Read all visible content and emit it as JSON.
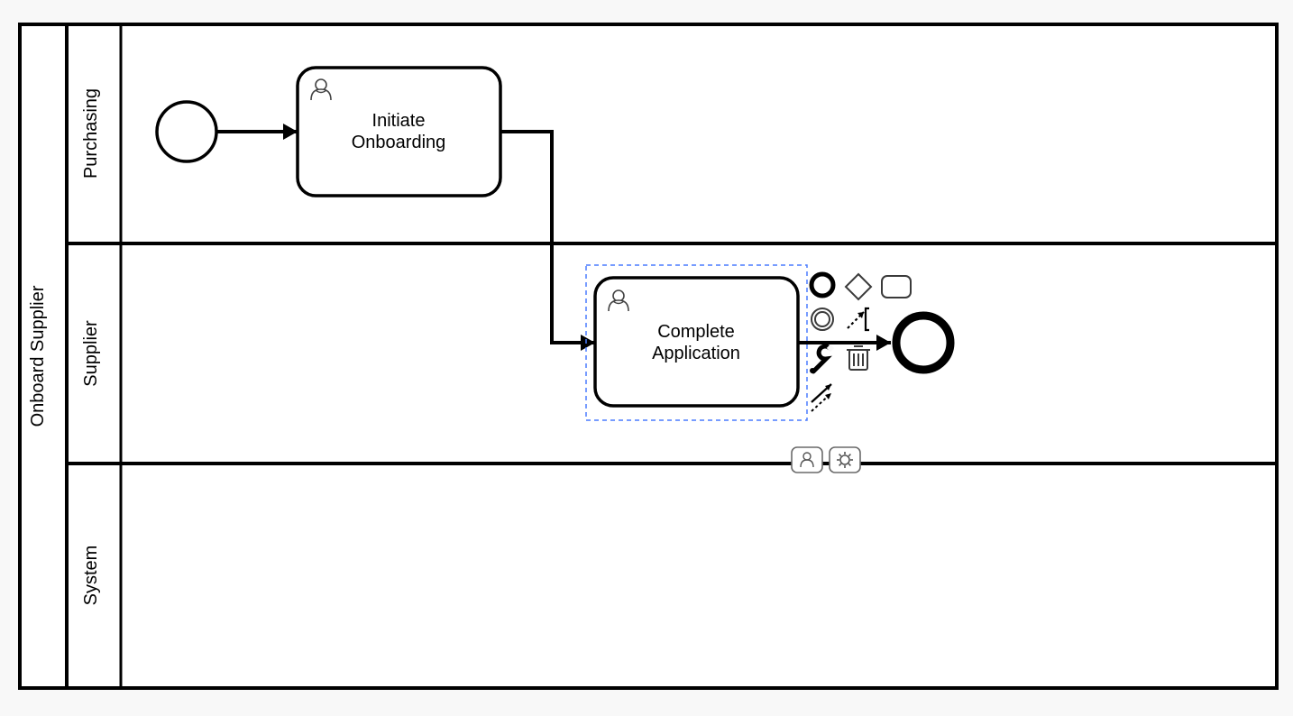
{
  "pool": {
    "title": "Onboard Supplier",
    "lanes": [
      {
        "id": "lane-purchasing",
        "label": "Purchasing"
      },
      {
        "id": "lane-supplier",
        "label": "Supplier"
      },
      {
        "id": "lane-system",
        "label": "System"
      }
    ]
  },
  "tasks": {
    "initiate": {
      "label_line1": "Initiate",
      "label_line2": "Onboarding"
    },
    "complete": {
      "label_line1": "Complete",
      "label_line2": "Application"
    }
  },
  "contextPad": {
    "items": [
      {
        "id": "append-end-event",
        "icon": "circle-thick"
      },
      {
        "id": "append-gateway",
        "icon": "diamond"
      },
      {
        "id": "append-task",
        "icon": "rounded-rect"
      },
      {
        "id": "append-intermediate-event",
        "icon": "double-circle"
      },
      {
        "id": "append-annotation",
        "icon": "annotation"
      },
      {
        "id": "change-type",
        "icon": "wrench"
      },
      {
        "id": "delete",
        "icon": "trash"
      },
      {
        "id": "connect",
        "icon": "connect-arrows"
      }
    ],
    "attach": [
      {
        "id": "attach-user-task",
        "icon": "user-small"
      },
      {
        "id": "attach-service-task",
        "icon": "gear-small"
      }
    ]
  },
  "endEvent": {
    "id": "end-event"
  }
}
